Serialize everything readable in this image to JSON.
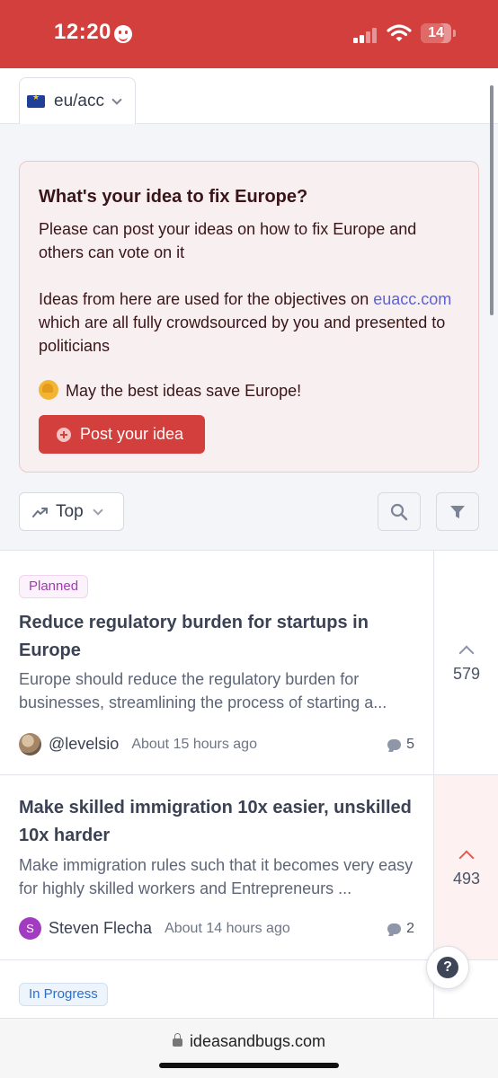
{
  "status_bar": {
    "time": "12:20",
    "battery": "14"
  },
  "topbar": {
    "community": "eu/acc"
  },
  "intro": {
    "title": "What's your idea to fix Europe?",
    "line1": "Please can post your ideas on how to fix Europe and others can vote on it",
    "line2_before": "Ideas from here are used for the objectives on ",
    "line2_link": "euacc.com",
    "line2_after": " which are all fully crowdsourced by you and presented to politicians",
    "line3": "May the best ideas save Europe!",
    "post_button": "Post your idea"
  },
  "toolbar": {
    "sort_label": "Top"
  },
  "posts": [
    {
      "badge": "Planned",
      "title": "Reduce regulatory burden for startups in Europe",
      "description": "Europe should reduce the regulatory burden for businesses, streamlining the process of starting a...",
      "author": "@levelsio",
      "time": "About 15 hours ago",
      "comments": "5",
      "votes": "579"
    },
    {
      "title": "Make skilled immigration 10x easier, unskilled 10x harder",
      "description": "Make immigration rules such that it becomes very easy for highly skilled workers and Entrepreneurs ...",
      "author_initial": "S",
      "author": "Steven Flecha",
      "time": "About 14 hours ago",
      "comments": "2",
      "votes": "493"
    },
    {
      "badge": "In Progress"
    }
  ],
  "help": {
    "label": "?"
  },
  "browser": {
    "url": "ideasandbugs.com"
  },
  "colors": {
    "brand_red": "#d23f3c",
    "link": "#5b63d6",
    "planned": "#a13bb0",
    "in_progress": "#2f6fc4"
  }
}
